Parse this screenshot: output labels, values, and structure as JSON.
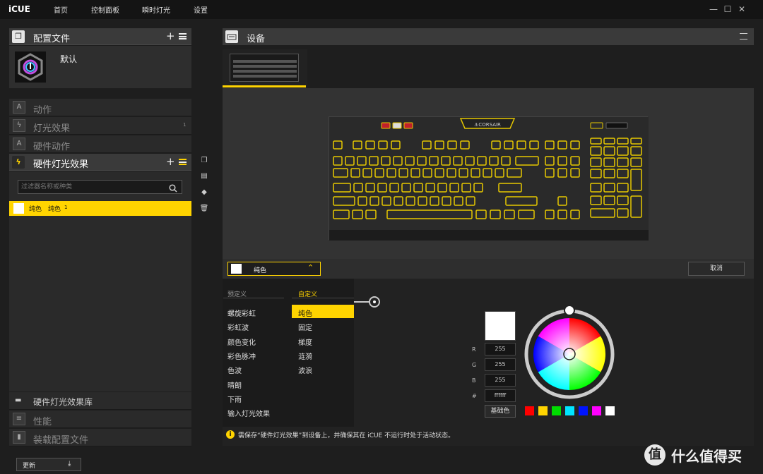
{
  "topbar": {
    "brand": "iCUE",
    "nav": [
      "首页",
      "控制面板",
      "瞬时灯光",
      "设置"
    ]
  },
  "sidebar": {
    "profiles_title": "配置文件",
    "profile_name": "默认",
    "sections": [
      {
        "label": "动作",
        "icon": "A"
      },
      {
        "label": "灯光效果",
        "icon": "bolt",
        "count": "1"
      },
      {
        "label": "硬件动作",
        "icon": "A"
      }
    ],
    "hw_lighting_title": "硬件灯光效果",
    "filter_placeholder": "过滤器名称或种类",
    "effect_item": {
      "name": "纯色",
      "type": "纯色",
      "count": "1"
    },
    "bottom_sections": [
      {
        "label": "硬件灯光效果库"
      },
      {
        "label": "性能"
      },
      {
        "label": "装载配置文件"
      }
    ],
    "update_label": "更新"
  },
  "device": {
    "title": "设备"
  },
  "effect_panel": {
    "selected_effect": "纯色",
    "cancel_label": "取消",
    "predefined_header": "预定义",
    "custom_header": "自定义",
    "predefined": [
      "螺旋彩虹",
      "彩虹波",
      "颜色变化",
      "彩色脉冲",
      "色波",
      "晴朗",
      "下雨",
      "输入灯光效果"
    ],
    "custom": [
      "纯色",
      "固定",
      "梯度",
      "涟漪",
      "波浪"
    ],
    "selected_custom": "纯色",
    "rgb": {
      "r_label": "R",
      "r": "255",
      "g_label": "G",
      "g": "255",
      "b_label": "B",
      "b": "255",
      "hex_label": "#",
      "hex": "ffffff"
    },
    "base_color_label": "基础色",
    "swatches": [
      "#ff0000",
      "#ffd400",
      "#00dd00",
      "#00e5ff",
      "#0014ff",
      "#ff00ff",
      "#ffffff"
    ],
    "current_color": "#ffffff",
    "notice": "需保存“硬件灯光效果”到设备上，并确保其在 iCUE 不运行时处于活动状态。"
  },
  "accent_color": "#ffd400",
  "watermark": "什么值得买"
}
